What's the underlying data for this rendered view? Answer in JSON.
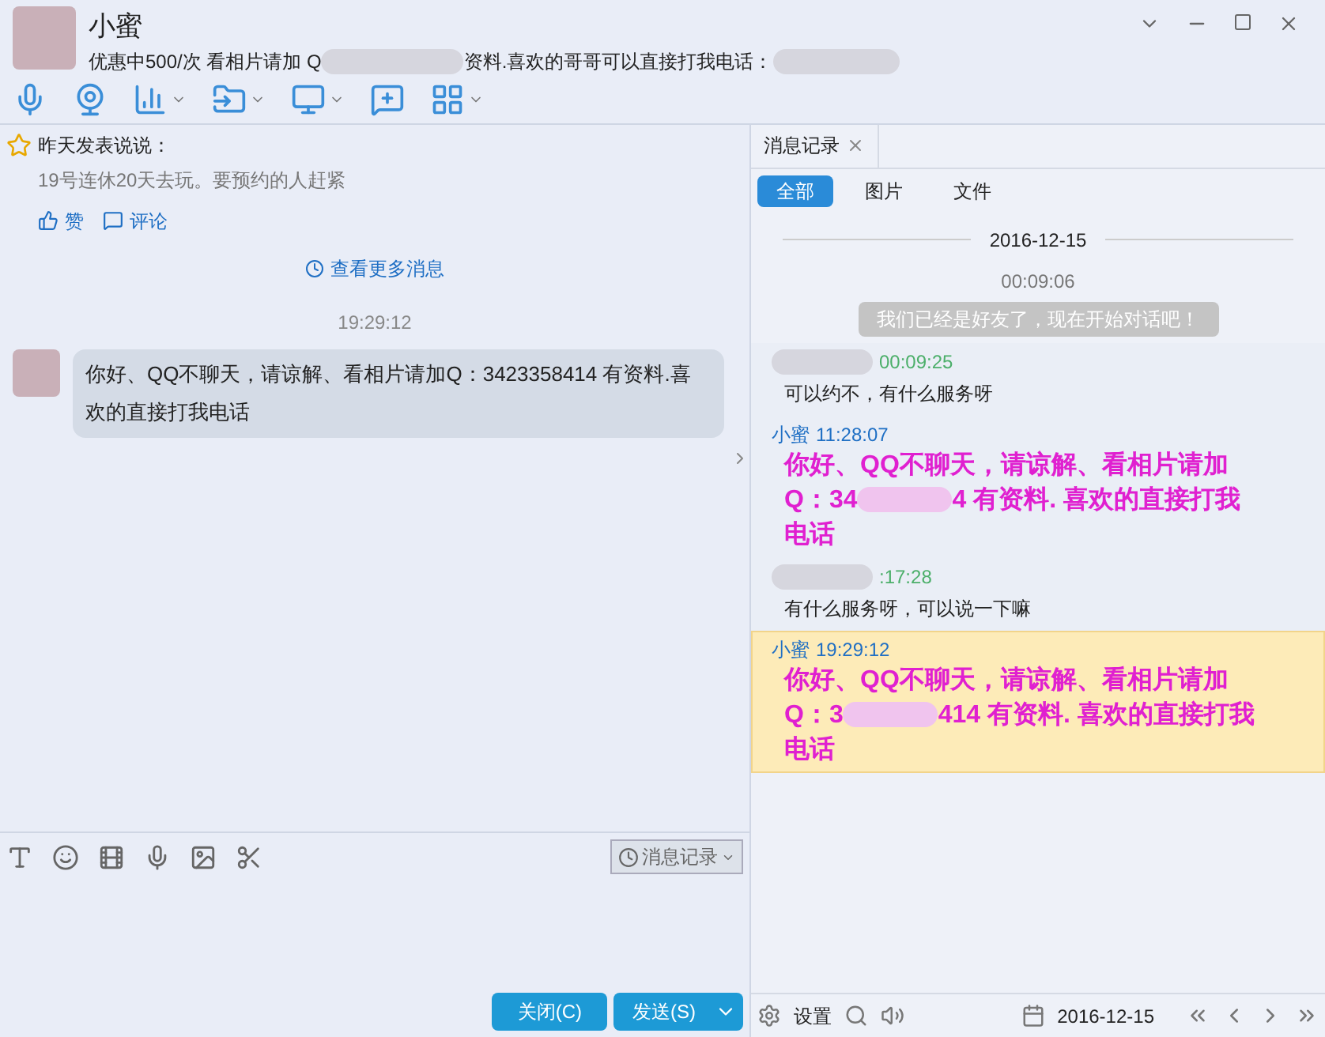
{
  "contact": {
    "name": "小蜜",
    "status_before": "优惠中500/次 看相片请加 Q",
    "status_after": "资料.喜欢的哥哥可以直接打我电话："
  },
  "feed": {
    "title": "昨天发表说说：",
    "text": "19号连休20天去玩。要预约的人赶紧",
    "actions": [
      {
        "kind": "like",
        "label": "赞"
      },
      {
        "kind": "comment",
        "label": "评论"
      }
    ],
    "more": "查看更多消息"
  },
  "chat": {
    "time": "19:29:12",
    "message": "你好、QQ不聊天，请谅解、看相片请加Q：3423358414 有资料.喜欢的直接打我电话"
  },
  "input": {
    "history_button": "消息记录",
    "close_button": "关闭(C)",
    "send_button": "发送(S)"
  },
  "history": {
    "tab": "消息记录",
    "filters": [
      {
        "label": "全部",
        "selected": true
      },
      {
        "label": "图片",
        "selected": false
      },
      {
        "label": "文件",
        "selected": false
      }
    ],
    "date": "2016-12-15",
    "system_time": "00:09:06",
    "notice": "我们已经是好友了，现在开始对话吧！",
    "records": [
      {
        "kind": "peer",
        "time": "00:09:25",
        "before": "可以约不，有什么服务呀",
        "selected": false
      },
      {
        "kind": "self",
        "sender": "小蜜",
        "time": "11:28:07",
        "before": "你好、QQ不聊天，请谅解、看相片请加Q：34",
        "after": "4 有资料. 喜欢的直接打我电话",
        "selected": false
      },
      {
        "kind": "peer",
        "time": ":17:28",
        "before": "有什么服务呀，可以说一下嘛",
        "selected": false
      },
      {
        "kind": "self",
        "sender": "小蜜",
        "time": "19:29:12",
        "before": "你好、QQ不聊天，请谅解、看相片请加Q：3",
        "after": "414 有资料. 喜欢的直接打我电话",
        "selected": true
      }
    ],
    "settings": "设置",
    "footer_date": "2016-12-15"
  }
}
